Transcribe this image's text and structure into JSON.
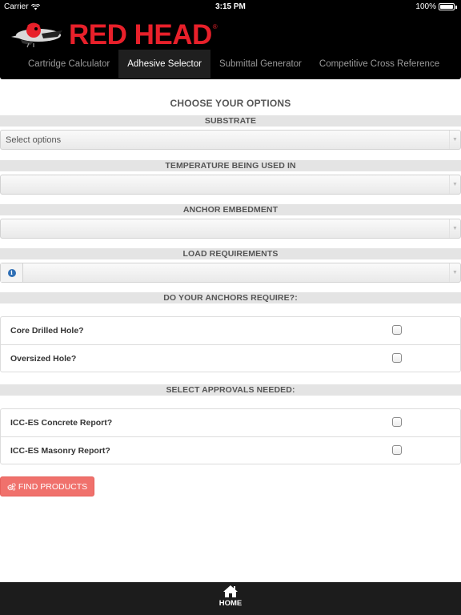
{
  "status_bar": {
    "carrier": "Carrier",
    "time": "3:15 PM",
    "battery": "100%"
  },
  "header": {
    "logo_text": "RED HEAD",
    "logo_mark": "®",
    "tabs": [
      {
        "label": "Cartridge Calculator",
        "active": false
      },
      {
        "label": "Adhesive Selector",
        "active": true
      },
      {
        "label": "Submittal Generator",
        "active": false
      },
      {
        "label": "Competitive Cross Reference",
        "active": false
      }
    ]
  },
  "main": {
    "heading": "CHOOSE YOUR OPTIONS",
    "substrate": {
      "label": "SUBSTRATE",
      "value": "Select options"
    },
    "temperature": {
      "label": "TEMPERATURE BEING USED IN",
      "value": ""
    },
    "embedment": {
      "label": "ANCHOR EMBEDMENT",
      "value": ""
    },
    "load": {
      "label": "LOAD REQUIREMENTS",
      "value": ""
    },
    "require": {
      "label": "DO YOUR ANCHORS REQUIRE?:",
      "options": [
        {
          "label": "Core Drilled Hole?",
          "checked": false
        },
        {
          "label": "Oversized Hole?",
          "checked": false
        }
      ]
    },
    "approvals": {
      "label": "SELECT APPROVALS NEEDED:",
      "options": [
        {
          "label": "ICC-ES Concrete Report?",
          "checked": false
        },
        {
          "label": "ICC-ES Masonry Report?",
          "checked": false
        }
      ]
    },
    "find_button_label": "FIND PRODUCTS"
  },
  "bottom_bar": {
    "home_label": "HOME"
  },
  "colors": {
    "brand_red": "#e8202a",
    "button_red": "#f0716c",
    "header_bg": "#000000"
  }
}
